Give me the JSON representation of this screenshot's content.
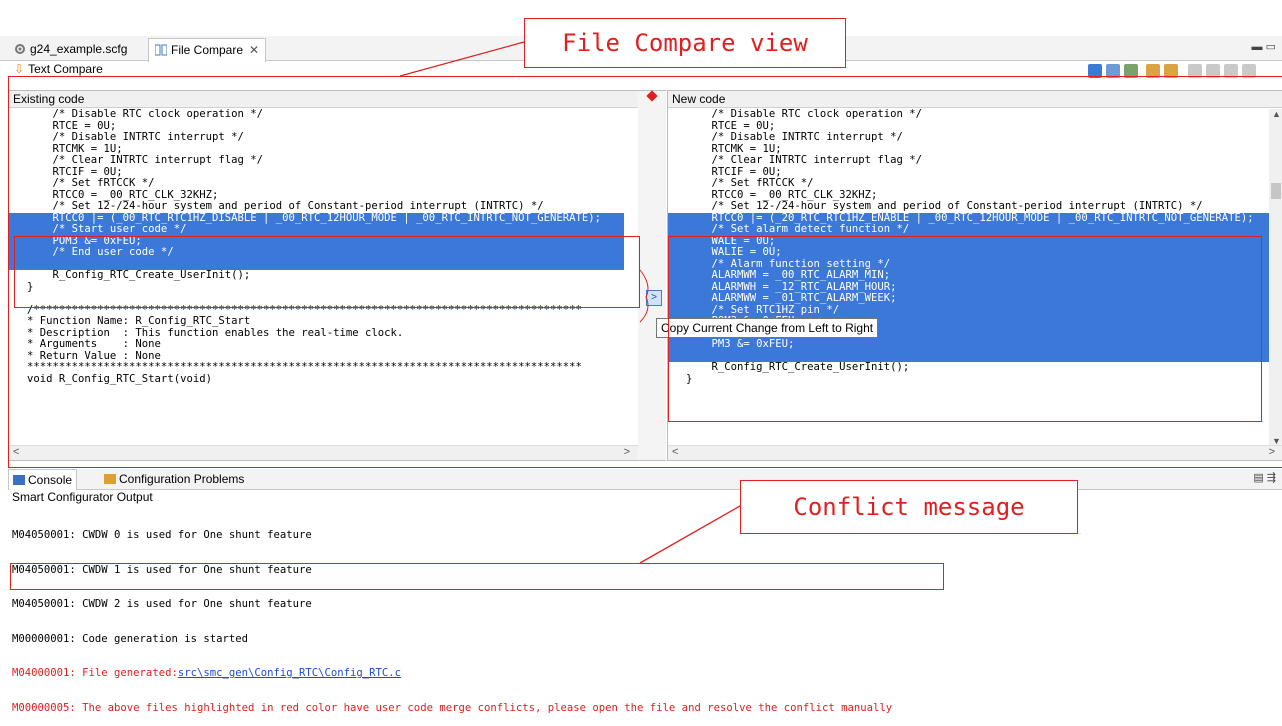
{
  "tabs": [
    {
      "label": "g24_example.scfg",
      "icon": "gear-icon"
    },
    {
      "label": "File Compare",
      "icon": "compare-icon",
      "close": "✕"
    }
  ],
  "text_compare_label": "Text Compare",
  "left_pane": {
    "header": "Existing code",
    "lines": [
      "    /* Disable RTC clock operation */",
      "    RTCE = 0U;",
      "    /* Disable INTRTC interrupt */",
      "    RTCMK = 1U;",
      "    /* Clear INTRTC interrupt flag */",
      "    RTCIF = 0U;",
      "    /* Set fRTCCK */",
      "    RTCC0 = _00_RTC_CLK_32KHZ;",
      "    /* Set 12-/24-hour system and period of Constant-period interrupt (INTRTC) */"
    ],
    "highlighted": [
      "    RTCC0 |= (_00_RTC_RTC1HZ_DISABLE | _00_RTC_12HOUR_MODE | _00_RTC_INTRTC_NOT_GENERATE);",
      "    /* Start user code */",
      "    POM3 &= 0xFEU;",
      "    /* End user code */"
    ],
    "after": [
      "    R_Config_RTC_Create_UserInit();",
      "}",
      "",
      "/**************************************************************************************",
      "* Function Name: R_Config_RTC_Start",
      "* Description  : This function enables the real-time clock.",
      "* Arguments    : None",
      "* Return Value : None",
      "***************************************************************************************",
      "void R_Config_RTC_Start(void)"
    ]
  },
  "right_pane": {
    "header": "New code",
    "lines": [
      "    /* Disable RTC clock operation */",
      "    RTCE = 0U;",
      "    /* Disable INTRTC interrupt */",
      "    RTCMK = 1U;",
      "    /* Clear INTRTC interrupt flag */",
      "    RTCIF = 0U;",
      "    /* Set fRTCCK */",
      "    RTCC0 = _00_RTC_CLK_32KHZ;",
      "    /* Set 12-/24-hour system and period of Constant-period interrupt (INTRTC) */"
    ],
    "highlighted": [
      "    RTCC0 |= (_20_RTC_RTC1HZ_ENABLE | _00_RTC_12HOUR_MODE | _00_RTC_INTRTC_NOT_GENERATE);",
      "    /* Set alarm detect function */",
      "    WALE = 0U;",
      "    WALIE = 0U;",
      "    /* Alarm function setting */",
      "    ALARMWM = _00_RTC_ALARM_MIN;",
      "    ALARMWH = _12_RTC_ALARM_HOUR;",
      "    ALARMWW = _01_RTC_ALARM_WEEK;",
      "    /* Set RTC1HZ pin */",
      "    POM3 &= 0xFEU;",
      "    P3 &= 0xFEU;",
      "    PM3 &= 0xFEU;"
    ],
    "after": [
      "    R_Config_RTC_Create_UserInit();",
      "}"
    ]
  },
  "tooltip": "Copy Current Change from Left to Right",
  "copy_button": ">",
  "annotations": {
    "file_compare_view": "File Compare view",
    "conflict_message": "Conflict message"
  },
  "bottom_tabs": [
    {
      "label": "Console",
      "icon": "console-icon"
    },
    {
      "label": "Configuration Problems",
      "icon": "problems-icon"
    }
  ],
  "console": {
    "title": "Smart Configurator Output",
    "lines": [
      "M04050001: CWDW 0 is used for One shunt feature",
      "M04050001: CWDW 1 is used for One shunt feature",
      "M04050001: CWDW 2 is used for One shunt feature",
      "M00000001: Code generation is started"
    ],
    "error1_prefix": "M04000001: File generated:",
    "error1_link": "src\\smc_gen\\Config_RTC\\Config_RTC.c",
    "error2": "M00000005: The above files highlighted in red color have user code merge conflicts, please open the file and resolve the conflict manually"
  },
  "colors": {
    "highlight": "#3b78d8",
    "annotation_red": "#e02020",
    "link": "#1a4dd0"
  }
}
